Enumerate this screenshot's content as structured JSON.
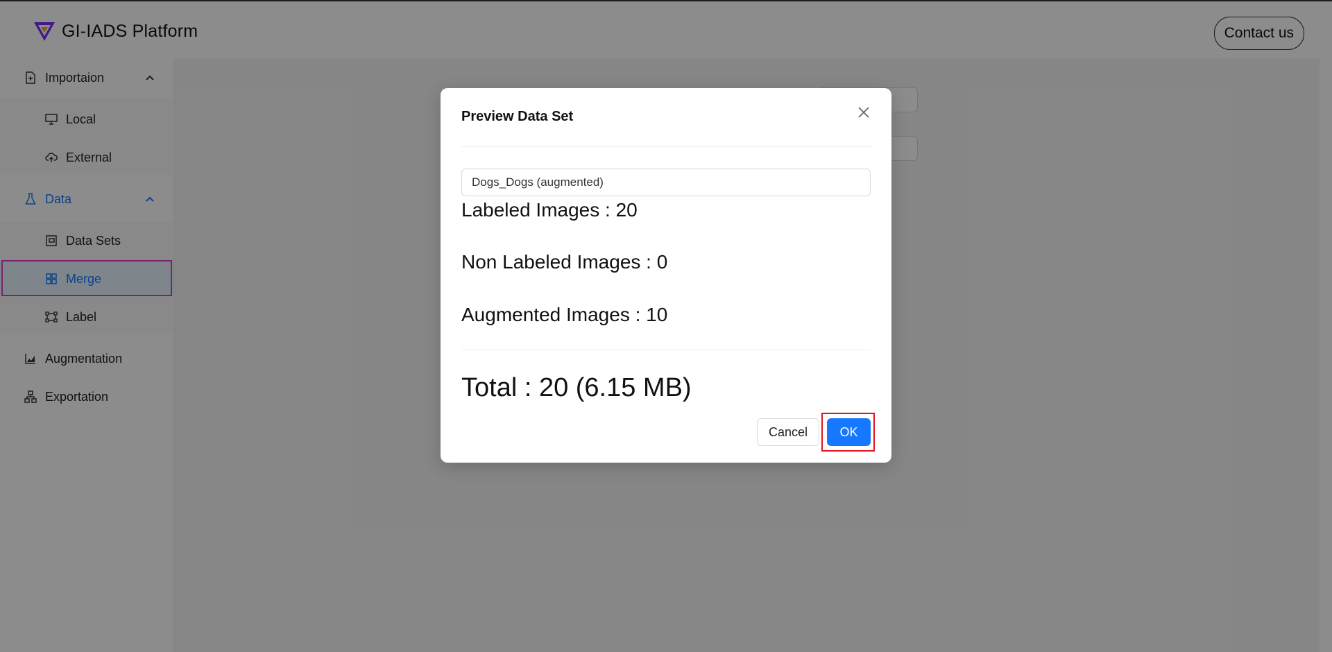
{
  "header": {
    "app_title": "GI-IADS Platform",
    "contact_label": "Contact us",
    "logo_colors": [
      "#7b2ff7",
      "#f5a623"
    ]
  },
  "sidebar": {
    "groups": [
      {
        "label": "Importaion",
        "icon": "file-import-icon",
        "expanded": true,
        "children": [
          {
            "label": "Local",
            "icon": "monitor-icon"
          },
          {
            "label": "External",
            "icon": "cloud-upload-icon"
          }
        ]
      },
      {
        "label": "Data",
        "icon": "flask-icon",
        "expanded": true,
        "active": true,
        "children": [
          {
            "label": "Data Sets",
            "icon": "dataset-icon"
          },
          {
            "label": "Merge",
            "icon": "merge-icon",
            "selected": true
          },
          {
            "label": "Label",
            "icon": "label-frame-icon"
          }
        ]
      },
      {
        "label": "Augmentation",
        "icon": "area-chart-icon"
      },
      {
        "label": "Exportation",
        "icon": "hierarchy-icon"
      }
    ]
  },
  "modal": {
    "title": "Preview Data Set",
    "dataset_value": "Dogs_Dogs (augmented)",
    "labeled": "Labeled Images : 20",
    "non_labeled": "Non Labeled Images : 0",
    "augmented": "Augmented Images : 10",
    "total": "Total : 20 (6.15 MB)",
    "cancel_label": "Cancel",
    "ok_label": "OK"
  },
  "colors": {
    "accent": "#1677ff",
    "selected_bg": "#e6f4ff",
    "highlight_ok": "#e0141e",
    "highlight_menu": "#e040c8"
  }
}
